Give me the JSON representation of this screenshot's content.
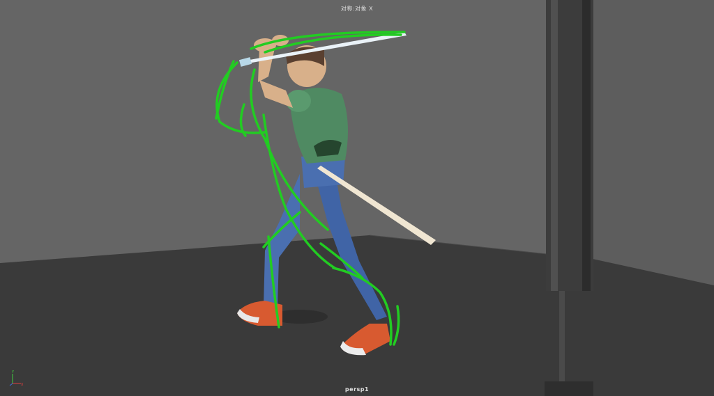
{
  "viewport": {
    "symmetry_label": "对称:对象 X",
    "camera_name": "persp1"
  },
  "axis_gizmo": {
    "x_label": "X",
    "y_label": "Y",
    "z_label": "Z",
    "x_color": "#e04040",
    "y_color": "#40d040",
    "z_color": "#4070e0"
  },
  "colors": {
    "floor": "#393939",
    "wall_back": "#626262",
    "wall_right": "#5a5a5a",
    "annotation_stroke": "#22cc22",
    "shirt": "#4f8a62",
    "pants": "#4a6fb0",
    "skin": "#d8b08a",
    "hair": "#5a4030",
    "shoe": "#d85a30",
    "sword": "#f0e6d2"
  }
}
